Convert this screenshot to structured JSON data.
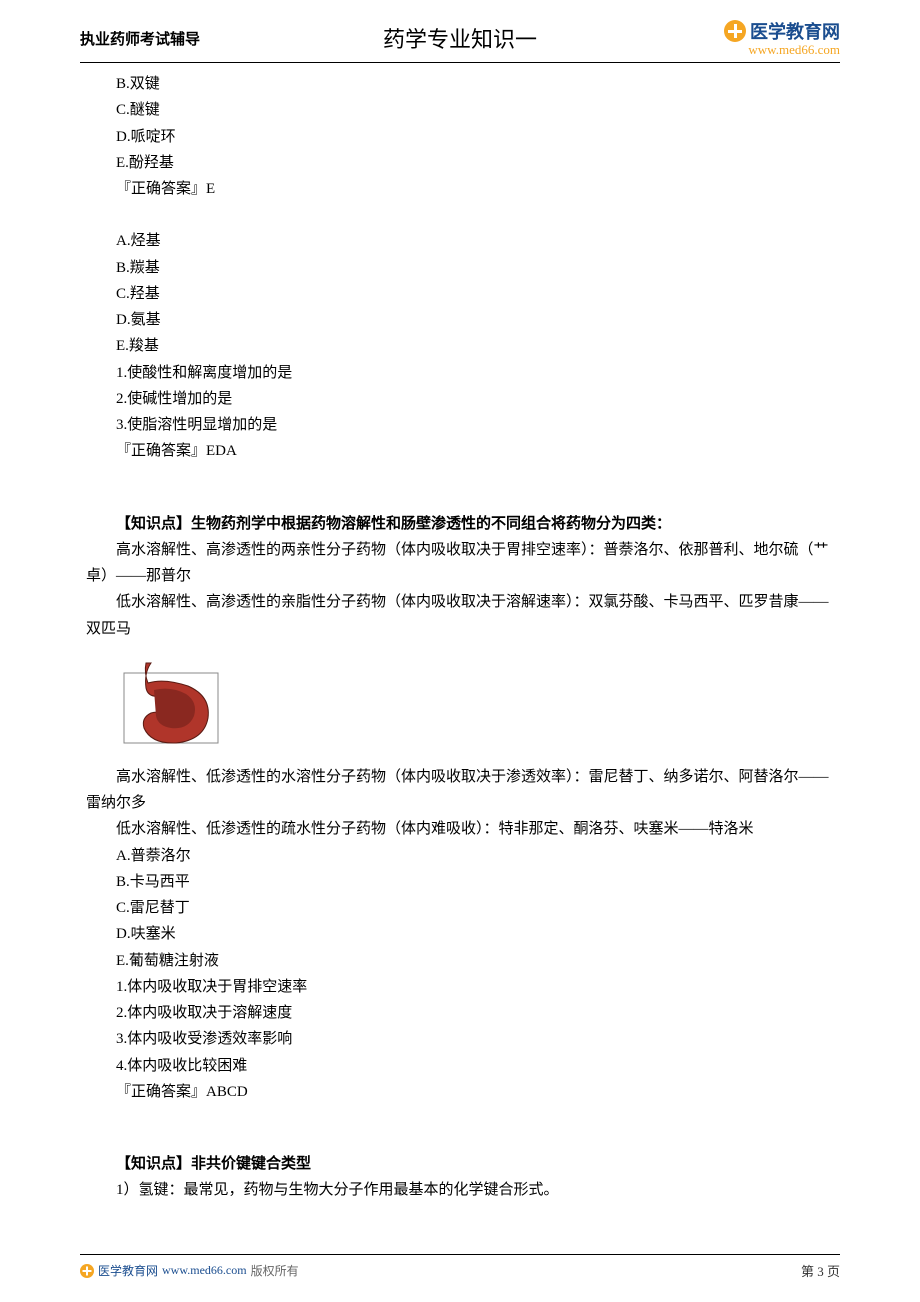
{
  "header": {
    "left": "执业药师考试辅导",
    "center": "药学专业知识一",
    "brand_name": "医学教育网",
    "brand_url": "www.med66.com"
  },
  "section1": {
    "options": {
      "B": "B.双键",
      "C": "C.醚键",
      "D": "D.哌啶环",
      "E": "E.酚羟基"
    },
    "answer_line": "『正确答案』E"
  },
  "section2": {
    "options": {
      "A": "A.烃基",
      "B": "B.羰基",
      "C": "C.羟基",
      "D": "D.氨基",
      "E": "E.羧基"
    },
    "q1": "1.使酸性和解离度增加的是",
    "q2": "2.使碱性增加的是",
    "q3": "3.使脂溶性明显增加的是",
    "answer_line": "『正确答案』EDA"
  },
  "kp1": {
    "title": "【知识点】生物药剂学中根据药物溶解性和肠壁渗透性的不同组合将药物分为四类：",
    "p1": "高水溶解性、高渗透性的两亲性分子药物（体内吸收取决于胃排空速率）：普萘洛尔、依那普利、地尔硫（艹卓）——那普尔",
    "p2": "低水溶解性、高渗透性的亲脂性分子药物（体内吸收取决于溶解速率）：双氯芬酸、卡马西平、匹罗昔康——双匹马",
    "p3": "高水溶解性、低渗透性的水溶性分子药物（体内吸收取决于渗透效率）：雷尼替丁、纳多诺尔、阿替洛尔——雷纳尔多",
    "p4": "低水溶解性、低渗透性的疏水性分子药物（体内难吸收）：特非那定、酮洛芬、呋塞米——特洛米"
  },
  "section3": {
    "options": {
      "A": "A.普萘洛尔",
      "B": "B.卡马西平",
      "C": "C.雷尼替丁",
      "D": "D.呋塞米",
      "E": "E.葡萄糖注射液"
    },
    "q1": "1.体内吸收取决于胃排空速率",
    "q2": "2.体内吸收取决于溶解速度",
    "q3": "3.体内吸收受渗透效率影响",
    "q4": "4.体内吸收比较困难",
    "answer_line": "『正确答案』ABCD"
  },
  "kp2": {
    "title": "【知识点】非共价键键合类型",
    "p1": "1）氢键：最常见，药物与生物大分子作用最基本的化学键合形式。"
  },
  "footer": {
    "brand": "医学教育网",
    "url": "www.med66.com",
    "copyright": "版权所有",
    "page": "第 3 页"
  }
}
